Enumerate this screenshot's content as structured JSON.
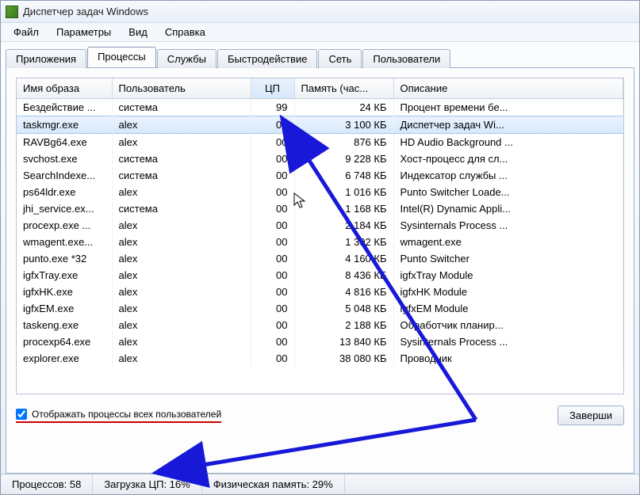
{
  "window": {
    "title": "Диспетчер задач Windows"
  },
  "menu": [
    "Файл",
    "Параметры",
    "Вид",
    "Справка"
  ],
  "tabs": [
    {
      "label": "Приложения",
      "active": false
    },
    {
      "label": "Процессы",
      "active": true
    },
    {
      "label": "Службы",
      "active": false
    },
    {
      "label": "Быстродействие",
      "active": false
    },
    {
      "label": "Сеть",
      "active": false
    },
    {
      "label": "Пользователи",
      "active": false
    }
  ],
  "columns": {
    "name": "Имя образа",
    "user": "Пользователь",
    "cpu": "ЦП",
    "mem": "Память (час...",
    "desc": "Описание"
  },
  "rows": [
    {
      "name": "Бездействие ...",
      "user": "система",
      "cpu": "99",
      "mem": "24 КБ",
      "desc": "Процент времени бе...",
      "selected": false
    },
    {
      "name": "taskmgr.exe",
      "user": "alex",
      "cpu": "00",
      "mem": "3 100 КБ",
      "desc": "Диспетчер задач Wi...",
      "selected": true
    },
    {
      "name": "RAVBg64.exe",
      "user": "alex",
      "cpu": "00",
      "mem": "876 КБ",
      "desc": "HD Audio Background ...",
      "selected": false
    },
    {
      "name": "svchost.exe",
      "user": "система",
      "cpu": "00",
      "mem": "9 228 КБ",
      "desc": "Хост-процесс для сл...",
      "selected": false
    },
    {
      "name": "SearchIndexe...",
      "user": "система",
      "cpu": "00",
      "mem": "6 748 КБ",
      "desc": "Индексатор службы ...",
      "selected": false
    },
    {
      "name": "ps64ldr.exe",
      "user": "alex",
      "cpu": "00",
      "mem": "1 016 КБ",
      "desc": "Punto Switcher Loade...",
      "selected": false
    },
    {
      "name": "jhi_service.ex...",
      "user": "система",
      "cpu": "00",
      "mem": "1 168 КБ",
      "desc": "Intel(R) Dynamic Appli...",
      "selected": false
    },
    {
      "name": "procexp.exe ...",
      "user": "alex",
      "cpu": "00",
      "mem": "2 184 КБ",
      "desc": "Sysinternals Process ...",
      "selected": false
    },
    {
      "name": "wmagent.exe...",
      "user": "alex",
      "cpu": "00",
      "mem": "1 392 КБ",
      "desc": "wmagent.exe",
      "selected": false
    },
    {
      "name": "punto.exe *32",
      "user": "alex",
      "cpu": "00",
      "mem": "4 160 КБ",
      "desc": "Punto Switcher",
      "selected": false
    },
    {
      "name": "igfxTray.exe",
      "user": "alex",
      "cpu": "00",
      "mem": "8 436 КБ",
      "desc": "igfxTray Module",
      "selected": false
    },
    {
      "name": "igfxHK.exe",
      "user": "alex",
      "cpu": "00",
      "mem": "4 816 КБ",
      "desc": "igfxHK Module",
      "selected": false
    },
    {
      "name": "igfxEM.exe",
      "user": "alex",
      "cpu": "00",
      "mem": "5 048 КБ",
      "desc": "igfxEM Module",
      "selected": false
    },
    {
      "name": "taskeng.exe",
      "user": "alex",
      "cpu": "00",
      "mem": "2 188 КБ",
      "desc": "Обработчик планир...",
      "selected": false
    },
    {
      "name": "procexp64.exe",
      "user": "alex",
      "cpu": "00",
      "mem": "13 840 КБ",
      "desc": "Sysinternals Process ...",
      "selected": false
    },
    {
      "name": "explorer.exe",
      "user": "alex",
      "cpu": "00",
      "mem": "38 080 КБ",
      "desc": "Проводник",
      "selected": false
    }
  ],
  "checkbox": {
    "label": "Отображать процессы всех пользователей",
    "checked": true
  },
  "button": {
    "end": "Заверши"
  },
  "status": {
    "processes": "Процессов: 58",
    "cpu": "Загрузка ЦП: 16%",
    "mem": "Физическая память: 29%"
  }
}
